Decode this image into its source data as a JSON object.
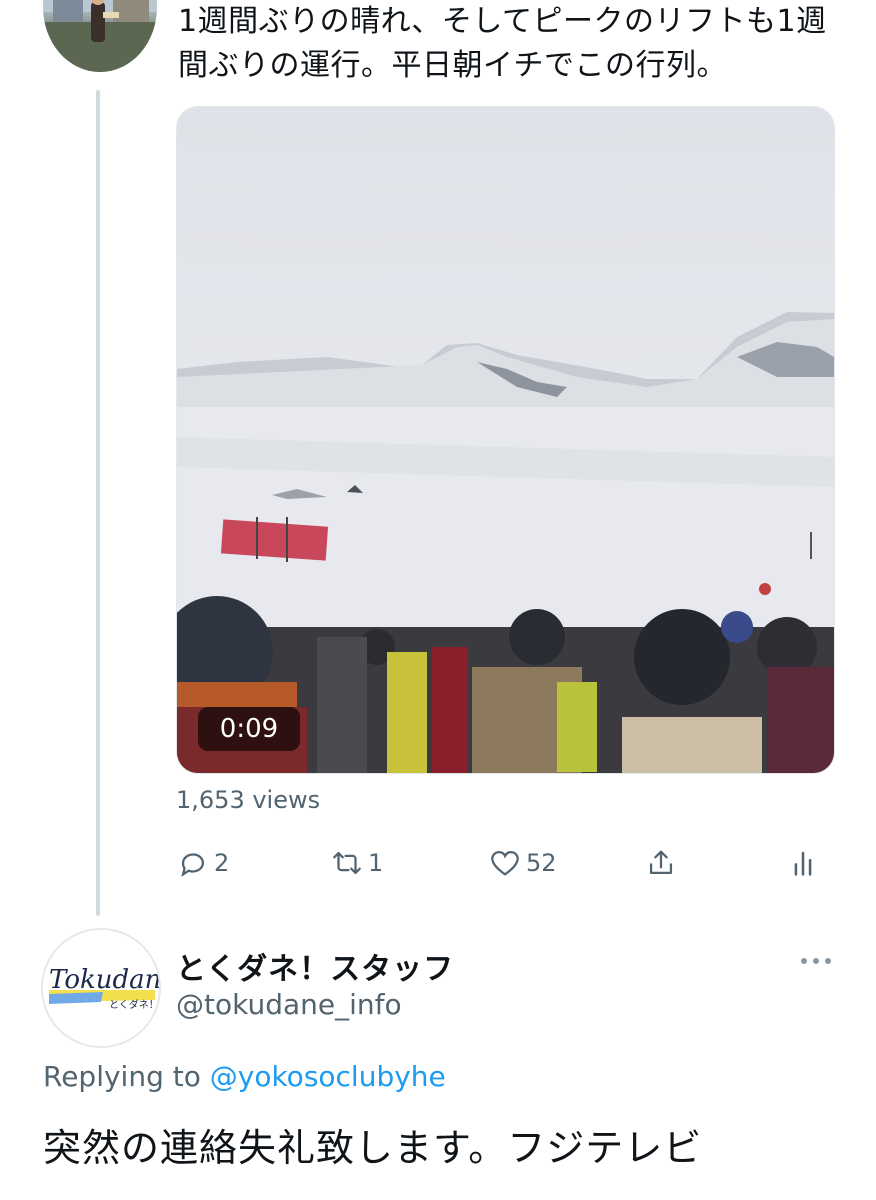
{
  "tweet1": {
    "text": "1週間ぶりの晴れ、そしてピークのリフトも1週間ぶりの運行。平日朝イチでこの行列。",
    "video_duration": "0:09",
    "views": "1,653 views",
    "reply_count": "2",
    "retweet_count": "1",
    "like_count": "52"
  },
  "tweet2": {
    "display_name": "とくダネ！スタッフ",
    "handle": "@tokudane_info",
    "avatar_logo_text": "Tokudane",
    "avatar_logo_subtext": "とくダネ！",
    "replying_prefix": "Replying to",
    "replying_mention": "@yokosoclubyhe",
    "text": "突然の連絡失礼致します。フジテレビ"
  },
  "icons": {
    "reply": "reply-icon",
    "retweet": "retweet-icon",
    "like": "heart-icon",
    "share": "share-icon",
    "stats": "analytics-icon",
    "more": "more-icon"
  },
  "colors": {
    "secondary_text": "#536471",
    "link": "#1d9bf0",
    "thread_line": "#cfd9de"
  }
}
